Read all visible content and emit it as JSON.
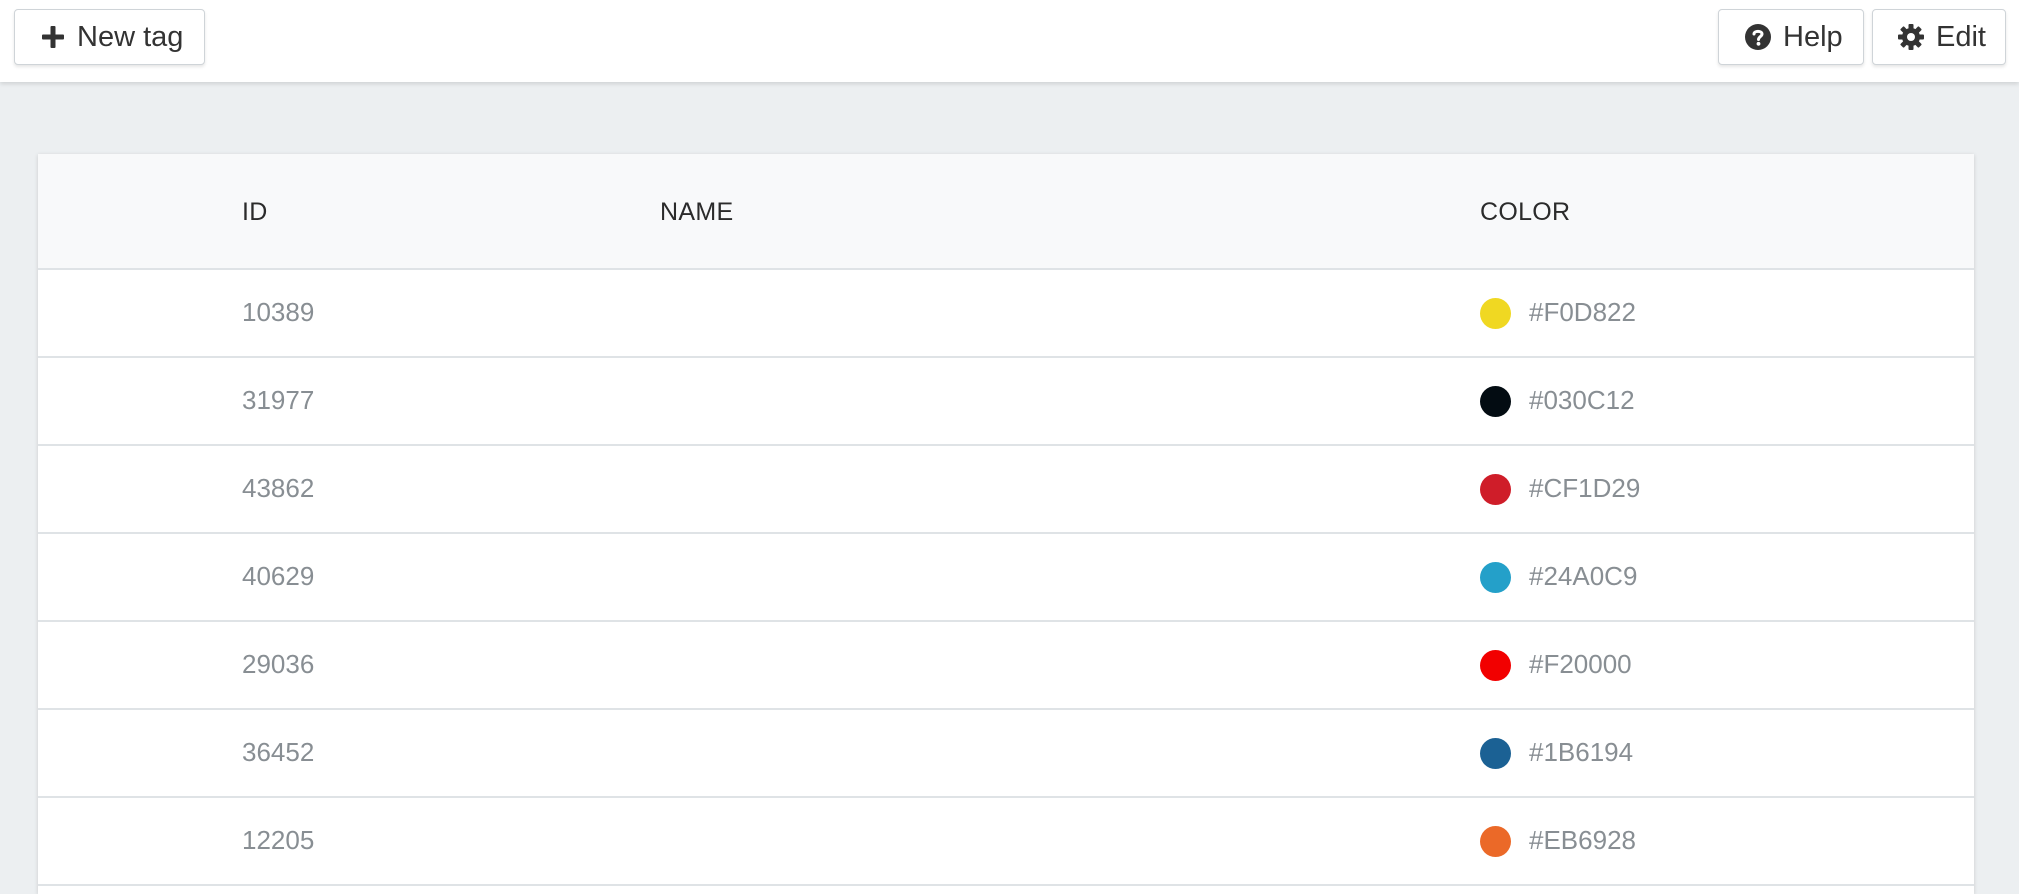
{
  "toolbar": {
    "new_tag_label": "New tag",
    "help_label": "Help",
    "edit_label": "Edit"
  },
  "table": {
    "headers": {
      "id": "ID",
      "name": "NAME",
      "color": "COLOR"
    },
    "rows": [
      {
        "id": "10389",
        "name": "",
        "color": "#F0D822"
      },
      {
        "id": "31977",
        "name": "",
        "color": "#030C12"
      },
      {
        "id": "43862",
        "name": "",
        "color": "#CF1D29"
      },
      {
        "id": "40629",
        "name": "",
        "color": "#24A0C9"
      },
      {
        "id": "29036",
        "name": "",
        "color": "#F20000"
      },
      {
        "id": "36452",
        "name": "",
        "color": "#1B6194"
      },
      {
        "id": "12205",
        "name": "",
        "color": "#EB6928"
      }
    ]
  },
  "icons": {
    "new_tag": "plus-icon",
    "help": "question-circle-icon",
    "edit": "gear-icon"
  }
}
